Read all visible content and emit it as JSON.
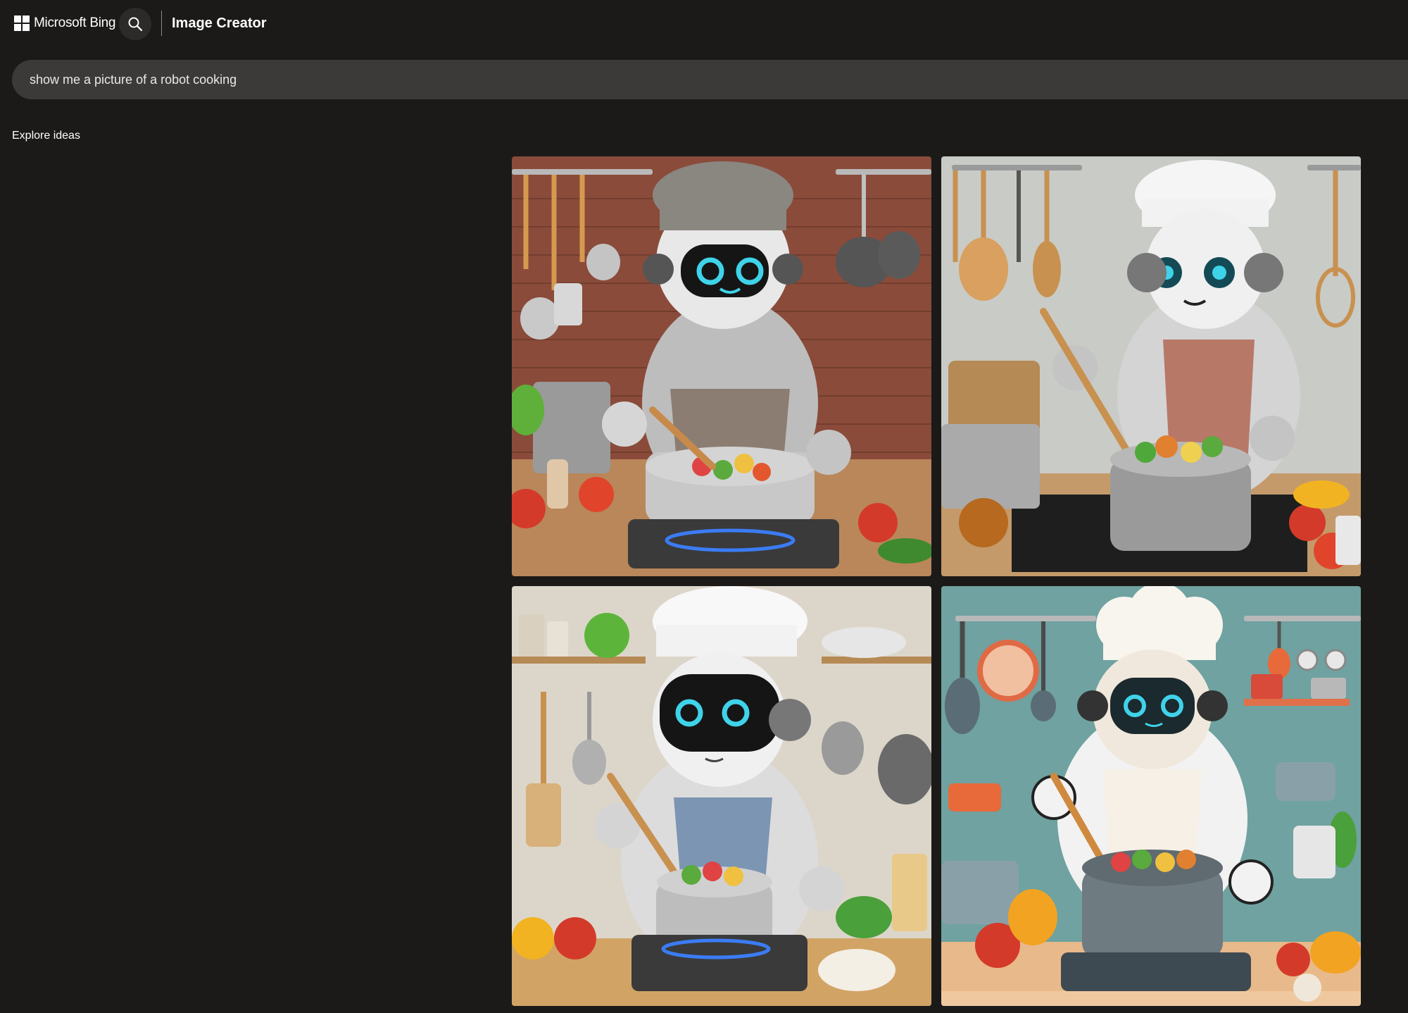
{
  "header": {
    "brand_label": "Microsoft Bing",
    "product_title": "Image Creator",
    "search_icon": "search-icon",
    "logo_icon": "windows-logo-icon"
  },
  "prompt": {
    "value": "show me a picture of a robot cooking"
  },
  "explore": {
    "label": "Explore ideas"
  },
  "results": {
    "images": [
      {
        "id": "robot-chef-brick-kitchen",
        "theme": "#8a4b3a"
      },
      {
        "id": "robot-chef-grey-kitchen",
        "theme": "#c9cbc6"
      },
      {
        "id": "robot-chef-shelf-kitchen",
        "theme": "#d9d4c8"
      },
      {
        "id": "robot-chef-teal-kitchen",
        "theme": "#6fa2a0"
      }
    ]
  },
  "colors": {
    "background": "#1b1a19",
    "prompt_bar": "#3b3a39",
    "text": "#ffffff"
  }
}
